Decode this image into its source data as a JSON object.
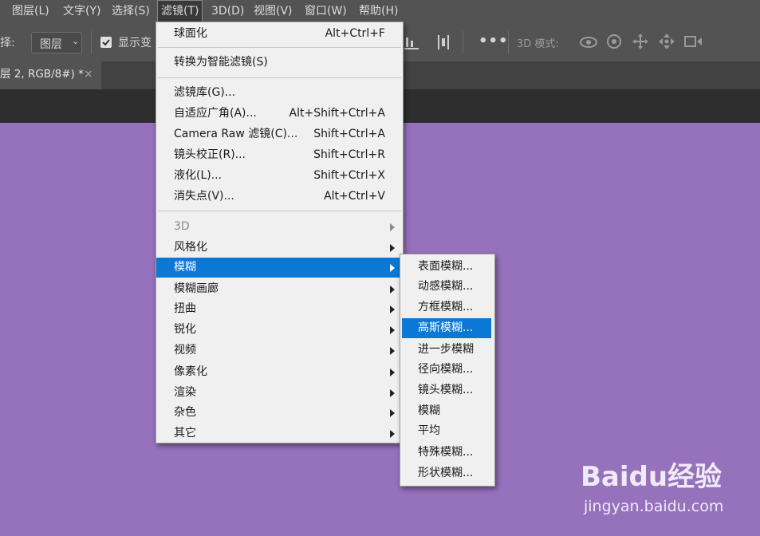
{
  "menubar": {
    "items": [
      {
        "label": "图层(L)"
      },
      {
        "label": "文字(Y)"
      },
      {
        "label": "选择(S)"
      },
      {
        "label": "滤镜(T)"
      },
      {
        "label": "3D(D)"
      },
      {
        "label": "视图(V)"
      },
      {
        "label": "窗口(W)"
      },
      {
        "label": "帮助(H)"
      }
    ],
    "active_item": "滤镜(T)"
  },
  "options_bar": {
    "select_prefix": "择:",
    "layer_dropdown_value": "图层",
    "show_transform_label": "显示变",
    "mode_3d_label": "3D 模式:"
  },
  "doc_tab": {
    "title": "层 2, RGB/8#) *",
    "close_glyph": "×"
  },
  "filter_menu": {
    "top_items": [
      {
        "label": "球面化",
        "shortcut": "Alt+Ctrl+F"
      }
    ],
    "smart_filter_label": "转换为智能滤镜(S)",
    "gallery_items": [
      {
        "label": "滤镜库(G)...",
        "shortcut": ""
      },
      {
        "label": "自适应广角(A)...",
        "shortcut": "Alt+Shift+Ctrl+A"
      },
      {
        "label": "Camera Raw 滤镜(C)...",
        "shortcut": "Shift+Ctrl+A"
      },
      {
        "label": "镜头校正(R)...",
        "shortcut": "Shift+Ctrl+R"
      },
      {
        "label": "液化(L)...",
        "shortcut": "Shift+Ctrl+X"
      },
      {
        "label": "消失点(V)...",
        "shortcut": "Alt+Ctrl+V"
      }
    ],
    "submenu_items": [
      {
        "label": "3D",
        "disabled": true
      },
      {
        "label": "风格化"
      },
      {
        "label": "模糊",
        "highlighted": true
      },
      {
        "label": "模糊画廊"
      },
      {
        "label": "扭曲"
      },
      {
        "label": "锐化"
      },
      {
        "label": "视频"
      },
      {
        "label": "像素化"
      },
      {
        "label": "渲染"
      },
      {
        "label": "杂色"
      },
      {
        "label": "其它"
      }
    ]
  },
  "blur_submenu": {
    "items": [
      {
        "label": "表面模糊..."
      },
      {
        "label": "动感模糊..."
      },
      {
        "label": "方框模糊..."
      },
      {
        "label": "高斯模糊...",
        "highlighted": true
      },
      {
        "label": "进一步模糊"
      },
      {
        "label": "径向模糊..."
      },
      {
        "label": "镜头模糊..."
      },
      {
        "label": "模糊"
      },
      {
        "label": "平均"
      },
      {
        "label": "特殊模糊..."
      },
      {
        "label": "形状模糊..."
      }
    ]
  },
  "watermark": {
    "brand": "Baidu经验",
    "url": "jingyan.baidu.com"
  },
  "colors": {
    "menubar_bg": "#535353",
    "canvas": "#9671bc",
    "highlight": "#0a78d4",
    "menu_bg": "#f0f0f0"
  },
  "icons": [
    "checkbox-checked-icon",
    "align-icon",
    "more-icon",
    "3d-orbit-icon",
    "3d-roll-icon",
    "3d-pan-icon",
    "3d-slide-icon",
    "3d-scale-icon"
  ]
}
